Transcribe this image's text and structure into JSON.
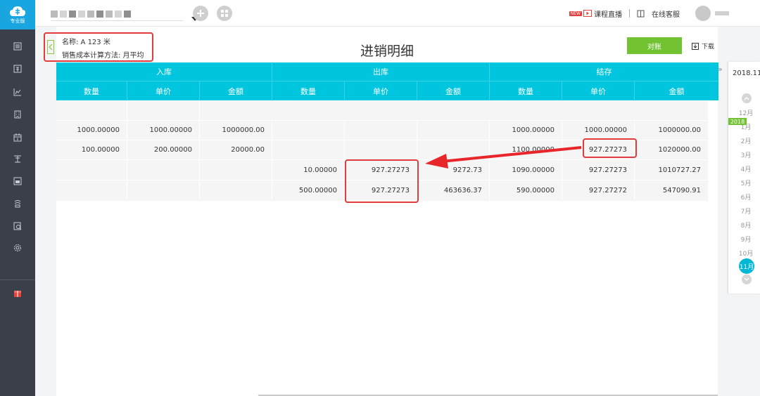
{
  "sidebar": {
    "logo_text": "专业版",
    "brand_color": "#19a6e0",
    "items": [
      {
        "icon": "ledger-icon"
      },
      {
        "icon": "voucher-icon"
      },
      {
        "icon": "report-chart-icon"
      },
      {
        "icon": "building-icon"
      },
      {
        "icon": "calendar-icon"
      },
      {
        "icon": "tax-icon"
      },
      {
        "icon": "invoice-icon"
      },
      {
        "icon": "inventory-icon"
      },
      {
        "icon": "search-doc-icon"
      },
      {
        "icon": "gear-icon"
      },
      {
        "icon": "red-gift-icon"
      }
    ]
  },
  "topbar": {
    "course_new_badge": "NEW",
    "course_label": "课程直播",
    "service_label": "在线客服"
  },
  "item_info": {
    "name_line": "名称: A 123 米",
    "method_line": "销售成本计算方法: 月平均"
  },
  "page": {
    "title": "进销明细",
    "reconcile_label": "对账",
    "download_label": "下载",
    "accent_color": "#00c5de",
    "button_color": "#72c232",
    "highlight_color": "#e23b3b"
  },
  "table": {
    "groups": [
      "入库",
      "出库",
      "结存"
    ],
    "columns": [
      "数量",
      "单价",
      "金额",
      "数量",
      "单价",
      "金额",
      "数量",
      "单价",
      "金额"
    ],
    "rows": [
      [
        "",
        "",
        "",
        "",
        "",
        "",
        "",
        "",
        ""
      ],
      [
        "1000.00000",
        "1000.00000",
        "1000000.00",
        "",
        "",
        "",
        "1000.00000",
        "1000.00000",
        "1000000.00"
      ],
      [
        "100.00000",
        "200.00000",
        "20000.00",
        "",
        "",
        "",
        "1100.00000",
        "927.27273",
        "1020000.00"
      ],
      [
        "",
        "",
        "",
        "10.00000",
        "927.27273",
        "9272.73",
        "1090.00000",
        "927.27273",
        "1010727.27"
      ],
      [
        "",
        "",
        "",
        "500.00000",
        "927.27273",
        "463636.37",
        "590.00000",
        "927.27272",
        "547090.91"
      ]
    ]
  },
  "period_panel": {
    "current_period": "2018.11",
    "year_tag": "2018",
    "months": [
      "12月",
      "1月",
      "2月",
      "3月",
      "4月",
      "5月",
      "6月",
      "7月",
      "8月",
      "9月",
      "10月"
    ],
    "current_month": "11月"
  }
}
